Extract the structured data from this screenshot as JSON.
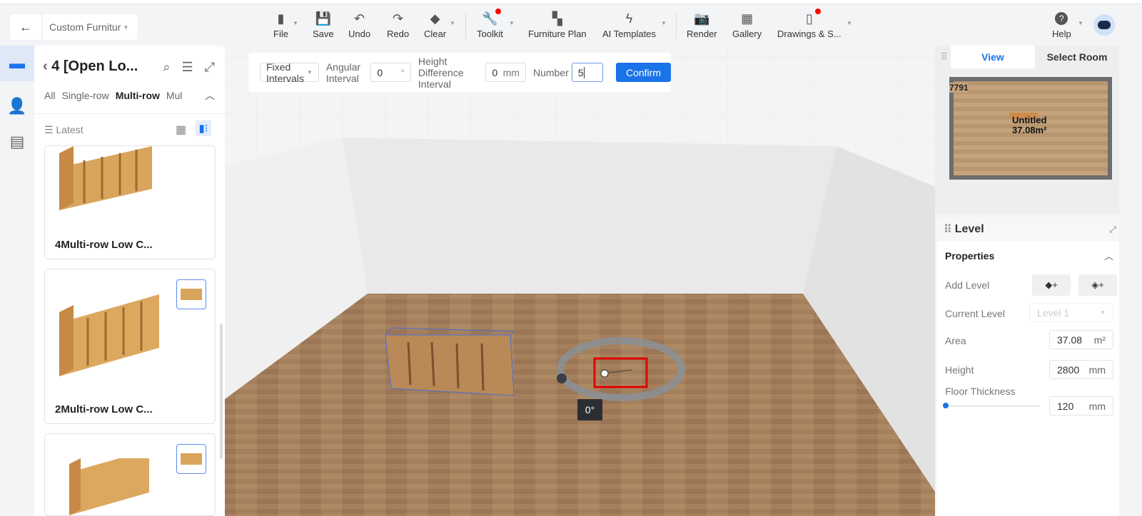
{
  "header": {
    "back_icon": "arrow-left-icon",
    "project_name": "Custom Furnitur",
    "tools": [
      {
        "label": "File",
        "icon": "file-icon"
      },
      {
        "label": "Save",
        "icon": "save-icon"
      },
      {
        "label": "Undo",
        "icon": "undo-icon"
      },
      {
        "label": "Redo",
        "icon": "redo-icon"
      },
      {
        "label": "Clear",
        "icon": "eraser-icon"
      },
      {
        "label": "Toolkit",
        "icon": "wrench-icon"
      },
      {
        "label": "Furniture Plan",
        "icon": "plan-icon"
      },
      {
        "label": "AI Templates",
        "icon": "lightning-icon"
      },
      {
        "label": "Render",
        "icon": "camera-icon"
      },
      {
        "label": "Gallery",
        "icon": "image-icon"
      },
      {
        "label": "Drawings & S...",
        "icon": "document-icon"
      },
      {
        "label": "Help",
        "icon": "help-icon"
      }
    ]
  },
  "left_panel": {
    "title": "4 [Open Lo...",
    "filters": [
      "All",
      "Single-row",
      "Multi-row",
      "Mul"
    ],
    "active_filter": "Multi-row",
    "sort_label": "Latest",
    "items": [
      {
        "name": "4Multi-row Low C..."
      },
      {
        "name": "2Multi-row Low C..."
      },
      {
        "name": ""
      }
    ]
  },
  "interval_bar": {
    "mode": "Fixed Intervals",
    "angular_label": "Angular Interval",
    "angular_value": "0",
    "angular_unit": "°",
    "height_label": "Height Difference Interval",
    "height_value": "0",
    "height_unit": "mm",
    "number_label": "Number",
    "number_value": "5",
    "confirm": "Confirm"
  },
  "scene": {
    "rotation_label": "0°"
  },
  "minimap": {
    "tabs": [
      "View",
      "Select Room"
    ],
    "active_tab": "View",
    "dimension": "7791",
    "room_name": "Untitled",
    "room_area": "37.08m²"
  },
  "level_panel": {
    "title": "Level",
    "section": "Properties",
    "add_level_label": "Add Level",
    "current_level_label": "Current Level",
    "current_level_value": "Level 1",
    "area_label": "Area",
    "area_value": "37.08",
    "area_unit": "m²",
    "height_label": "Height",
    "height_value": "2800",
    "height_unit": "mm",
    "floor_thickness_label": "Floor Thickness",
    "floor_thickness_value": "120",
    "floor_thickness_unit": "mm",
    "floor_thickness_slider": 0
  },
  "colors": {
    "accent": "#1a73e8",
    "notification": "#ff0000",
    "selection": "#e00000"
  }
}
